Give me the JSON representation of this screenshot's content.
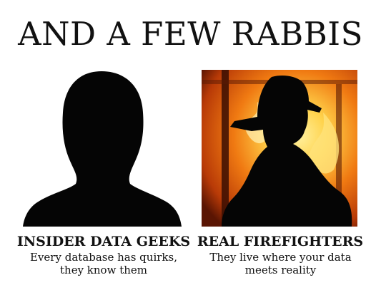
{
  "title": "AND A FEW RABBIS",
  "panels": [
    {
      "heading": "INSIDER DATA GEEKS",
      "caption": "Every database has quirks, they know them",
      "image": "hooded-silhouette"
    },
    {
      "heading": "REAL FIREFIGHTERS",
      "caption": "They live where your data meets reality",
      "image": "firefighter-silhouette-fire"
    }
  ],
  "colors": {
    "text": "#111111",
    "silhouette": "#050505",
    "fire_bright": "#ffd24a",
    "fire_mid": "#f07a12",
    "fire_dark": "#9b2a05"
  }
}
